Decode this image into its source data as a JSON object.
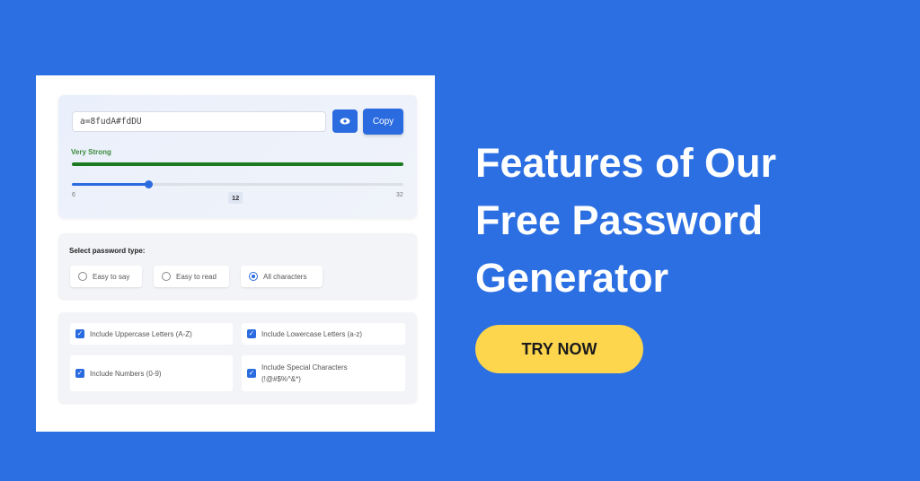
{
  "generator": {
    "password": "a=8fudA#fdDU",
    "eye_icon": "eye-icon",
    "copy_label": "Copy",
    "strength_label": "Very Strong",
    "strength_color": "#1b7a1f",
    "strength_fraction": 1.0,
    "length": {
      "min": "6",
      "max": "32",
      "value": "12"
    },
    "type_label": "Select password type:",
    "types": [
      {
        "label": "Easy to say",
        "selected": false
      },
      {
        "label": "Easy to read",
        "selected": false
      },
      {
        "label": "All characters",
        "selected": true
      }
    ],
    "options": [
      {
        "label": "Include Uppercase Letters (A-Z)",
        "checked": true
      },
      {
        "label": "Include Lowercase Letters (a-z)",
        "checked": true
      },
      {
        "label": "Include Numbers (0-9)",
        "checked": true
      },
      {
        "label": "Include Special Characters (!@#$%^&*)",
        "checked": true
      }
    ]
  },
  "promo": {
    "heading": "Features of Our Free Password Generator",
    "cta": "TRY NOW",
    "cta_color": "#fdd64e",
    "background": "#2b6fe2"
  }
}
